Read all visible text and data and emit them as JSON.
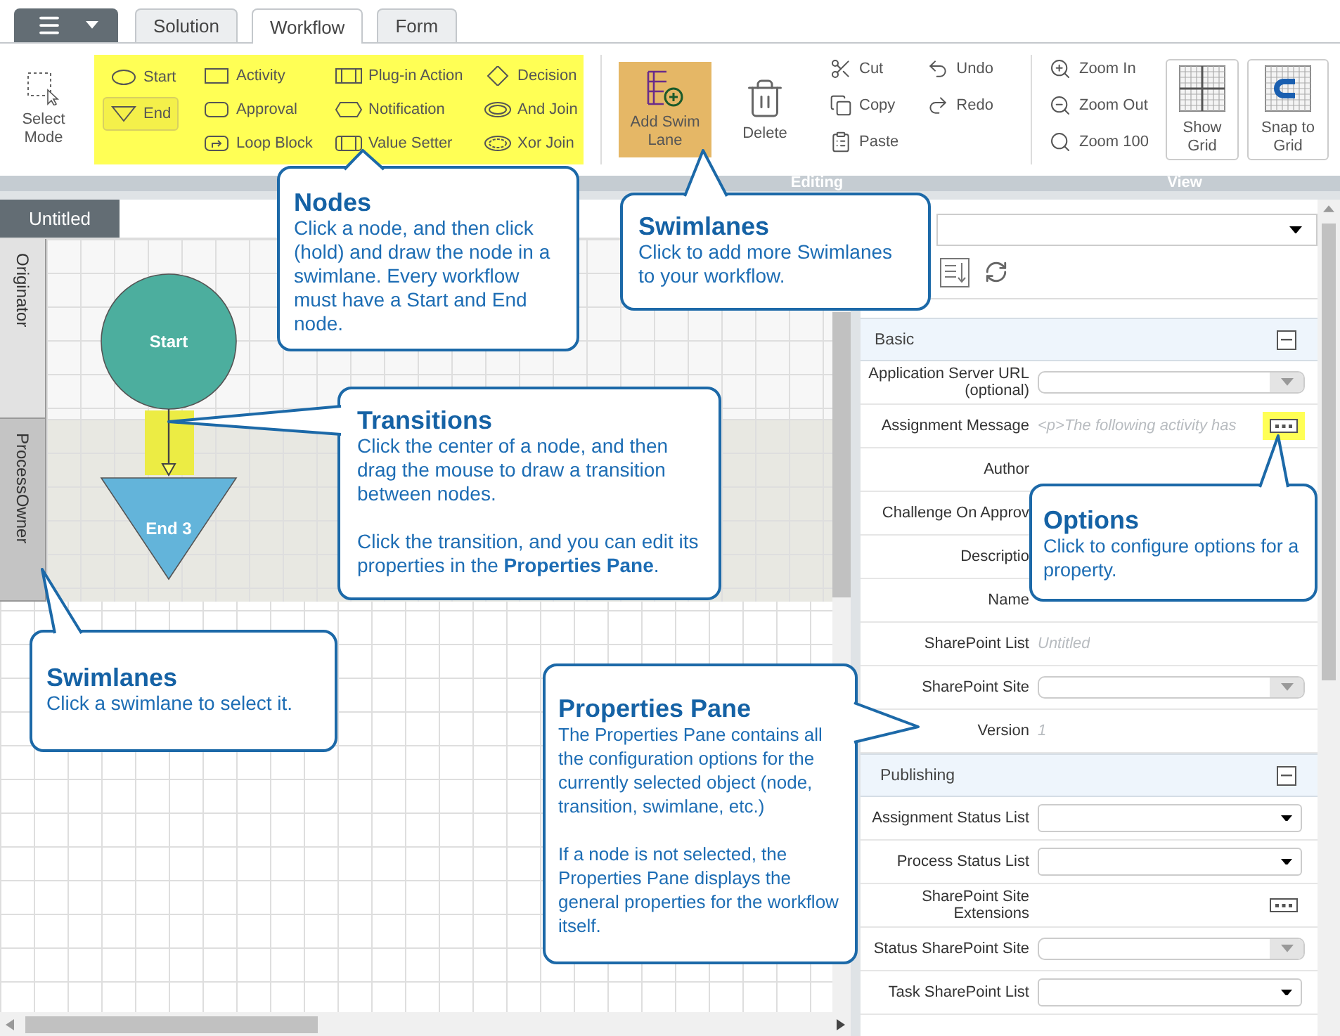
{
  "tabs": [
    {
      "label": "Solution",
      "selected": false
    },
    {
      "label": "Workflow",
      "selected": true
    },
    {
      "label": "Form",
      "selected": false
    }
  ],
  "ribbon": {
    "select_mode": {
      "label": "Select Mode"
    },
    "node_tools": {
      "highlighted": true,
      "columns": [
        [
          {
            "kind": "start",
            "label": "Start",
            "selected": false
          },
          {
            "kind": "end",
            "label": "End",
            "selected": true
          }
        ],
        [
          {
            "kind": "activity",
            "label": "Activity",
            "selected": false
          },
          {
            "kind": "approval",
            "label": "Approval",
            "selected": false
          },
          {
            "kind": "loop",
            "label": "Loop Block",
            "selected": false
          }
        ],
        [
          {
            "kind": "plugin",
            "label": "Plug-in Action",
            "selected": false
          },
          {
            "kind": "notification",
            "label": "Notification",
            "selected": false
          },
          {
            "kind": "setter",
            "label": "Value Setter",
            "selected": false
          }
        ],
        [
          {
            "kind": "decision",
            "label": "Decision",
            "selected": false
          },
          {
            "kind": "andjoin",
            "label": "And Join",
            "selected": false
          },
          {
            "kind": "xorjoin",
            "label": "Xor Join",
            "selected": false
          }
        ]
      ]
    },
    "add_swim_lane": {
      "label": "Add Swim Lane",
      "highlighted": true
    },
    "delete": {
      "label": "Delete"
    },
    "edit_commands": [
      [
        {
          "kind": "cut",
          "label": "Cut"
        },
        {
          "kind": "copy",
          "label": "Copy"
        },
        {
          "kind": "paste",
          "label": "Paste"
        }
      ],
      [
        {
          "kind": "undo",
          "label": "Undo"
        },
        {
          "kind": "redo",
          "label": "Redo"
        }
      ]
    ],
    "zoom_commands": [
      {
        "kind": "zoom_in",
        "label": "Zoom In"
      },
      {
        "kind": "zoom_out",
        "label": "Zoom Out"
      },
      {
        "kind": "zoom_100",
        "label": "Zoom 100"
      }
    ],
    "view_toggles": [
      {
        "kind": "grid",
        "label": "Show Grid"
      },
      {
        "kind": "snap",
        "label": "Snap to Grid"
      }
    ],
    "group_labels": [
      "Editing",
      "View"
    ]
  },
  "canvas": {
    "tab": "Untitled",
    "lanes": [
      {
        "name": "Originator",
        "selected": false
      },
      {
        "name": "ProcessOwner",
        "selected": true
      }
    ],
    "nodes": [
      {
        "kind": "start",
        "label": "Start"
      },
      {
        "kind": "end",
        "label": "End 3"
      }
    ],
    "transition": {
      "highlighted": true
    }
  },
  "properties": {
    "sections": [
      {
        "title": "Basic",
        "expanded": true,
        "rows": [
          {
            "label": "Application Server URL (optional)",
            "kind": "combo"
          },
          {
            "label": "Assignment Message",
            "kind": "options",
            "value": "<p>The following activity has",
            "highlighted": true
          },
          {
            "label": "Author",
            "kind": "empty"
          },
          {
            "label": "Challenge On Approv",
            "kind": "empty"
          },
          {
            "label": "Descriptio",
            "kind": "empty"
          },
          {
            "label": "Name",
            "kind": "empty"
          },
          {
            "label": "SharePoint List",
            "kind": "text",
            "value": "Untitled"
          },
          {
            "label": "SharePoint Site",
            "kind": "combo"
          },
          {
            "label": "Version",
            "kind": "text",
            "value": "1"
          }
        ]
      },
      {
        "title": "Publishing",
        "expanded": true,
        "rows": [
          {
            "label": "Assignment Status List",
            "kind": "select"
          },
          {
            "label": "Process Status List",
            "kind": "select"
          },
          {
            "label": "SharePoint Site Extensions",
            "kind": "options",
            "highlighted": false
          },
          {
            "label": "Status SharePoint Site",
            "kind": "combo"
          },
          {
            "label": "Task SharePoint List",
            "kind": "select"
          }
        ]
      }
    ]
  },
  "callouts": [
    {
      "title": "Nodes",
      "body": [
        "Click a node, and then click (hold) and draw the node in a swimlane. Every workflow must have a Start and End node."
      ]
    },
    {
      "title": "Swimlanes",
      "body": [
        "Click to add more Swimlanes to your workflow."
      ]
    },
    {
      "title": "Transitions",
      "body": [
        "Click the center of a node, and then drag the mouse to draw a transition between nodes.",
        "Click the transition, and you can edit its properties in the **Properties Pane**."
      ]
    },
    {
      "title": "Options",
      "body": [
        "Click to configure options for a property."
      ]
    },
    {
      "title": "Swimlanes",
      "body": [
        "Click a swimlane to select it."
      ]
    },
    {
      "title": "Properties Pane",
      "body": [
        "The Properties Pane contains all the configuration options for the currently selected object (node, transition, swimlane, etc.)",
        "If a node is not selected, the Properties Pane displays the general properties for the workflow itself."
      ]
    }
  ]
}
